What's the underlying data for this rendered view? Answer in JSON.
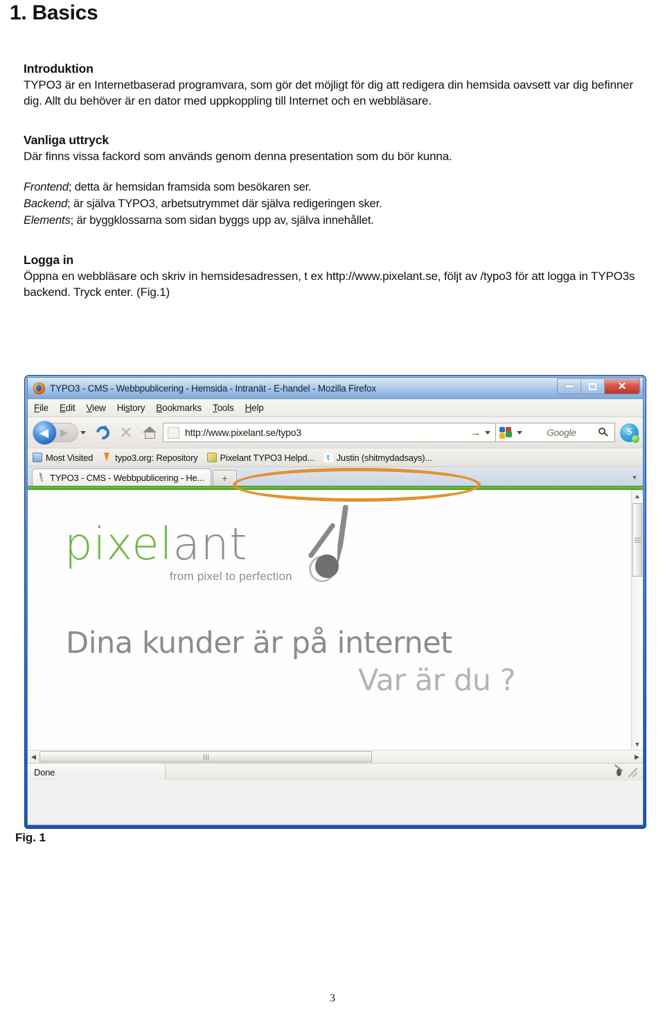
{
  "document": {
    "chapter_heading": "1. Basics",
    "sections": [
      {
        "heading": "Introduktion",
        "paragraph": "TYPO3 är en Internetbaserad programvara, som gör det möjligt för dig att redigera din hemsida oavsett var dig befinner dig. Allt du behöver är en dator med uppkoppling till Internet och en webbläsare."
      },
      {
        "heading": "Vanliga uttryck",
        "paragraph": "Där finns vissa fackord som används genom denna presentation som du bör kunna."
      }
    ],
    "terms": [
      {
        "term": "Frontend",
        "definition": "; detta är hemsidan framsida som besökaren ser."
      },
      {
        "term": "Backend",
        "definition": "; är själva TYPO3, arbetsutrymmet där själva redigeringen sker."
      },
      {
        "term": "Elements",
        "definition": "; är byggklossarna som sidan byggs upp av, själva innehållet."
      }
    ],
    "login_section": {
      "heading": "Logga in",
      "paragraph": "Öppna en webbläsare och skriv in hemsidesadressen, t ex http://www.pixelant.se, följt av /typo3 för att logga in TYPO3s backend. Tryck enter. (Fig.1)"
    },
    "figure_caption": "Fig. 1",
    "page_number": "3"
  },
  "browser": {
    "window_title": "TYPO3 - CMS - Webbpublicering - Hemsida - Intranät - E-handel - Mozilla Firefox",
    "app_icon": "firefox-icon",
    "window_controls": {
      "minimize": "minimize-icon",
      "maximize": "maximize-icon",
      "close": "close-icon"
    },
    "menu_items": [
      {
        "label": "File",
        "mnemonic": "F"
      },
      {
        "label": "Edit",
        "mnemonic": "E"
      },
      {
        "label": "View",
        "mnemonic": "V"
      },
      {
        "label": "History",
        "mnemonic": "s"
      },
      {
        "label": "Bookmarks",
        "mnemonic": "B"
      },
      {
        "label": "Tools",
        "mnemonic": "T"
      },
      {
        "label": "Help",
        "mnemonic": "H"
      }
    ],
    "toolbar": {
      "back_icon": "back-arrow-icon",
      "forward_icon": "forward-arrow-icon",
      "history_dropdown_icon": "chevron-down-icon",
      "reload_icon": "reload-icon",
      "stop_icon": "stop-icon",
      "home_icon": "home-icon",
      "skype_icon": "skype-icon"
    },
    "address_bar": {
      "url": "http://www.pixelant.se/typo3",
      "go_icon": "go-arrow-icon",
      "dropdown_icon": "chevron-down-icon",
      "favicon_placeholder": "favicon-placeholder"
    },
    "search_bar": {
      "engine": "google-icon",
      "placeholder": "Google",
      "search_icon": "search-icon",
      "engine_dropdown_icon": "chevron-down-icon"
    },
    "bookmarks": [
      {
        "label": "Most Visited",
        "icon": "most-visited-icon"
      },
      {
        "label": "typo3.org: Repository",
        "icon": "typo3-icon"
      },
      {
        "label": "Pixelant TYPO3 Helpd...",
        "icon": "pixelant-icon"
      },
      {
        "label": "Justin (shitmydadsays)...",
        "icon": "twitter-icon"
      }
    ],
    "tabs": [
      {
        "label": "TYPO3 - CMS - Webbpublicering - He...",
        "icon": "tab-favicon"
      }
    ],
    "new_tab_label": "+",
    "tab_scroll_icon": "chevron-right-icon",
    "status_bar": {
      "status_text": "Done",
      "bug_icon": "firebug-icon",
      "resize_grip": "resize-grip-icon"
    },
    "scrollbars": {
      "vertical_up_icon": "triangle-up-icon",
      "vertical_down_icon": "triangle-down-icon",
      "horizontal_left_icon": "triangle-left-icon",
      "horizontal_right_icon": "triangle-right-icon"
    }
  },
  "webpage": {
    "logo": {
      "word_part1": "pixel",
      "word_part2": "ant",
      "tagline": "from pixel to perfection",
      "mascot_icon": "ant-icon"
    },
    "headline_line1": "Dina kunder är på internet",
    "headline_line2": "Var är du ?"
  },
  "annotation": {
    "type": "ellipse-highlight",
    "target": "address-bar",
    "color": "#e6902d"
  },
  "colors": {
    "logo_green": "#6fb744",
    "logo_gray": "#8d8d8d",
    "annotation_orange": "#e6902d",
    "loadbar_green": "#4d9b28",
    "titlebar_blue": "#2f63b4",
    "close_red": "#b8352a"
  }
}
